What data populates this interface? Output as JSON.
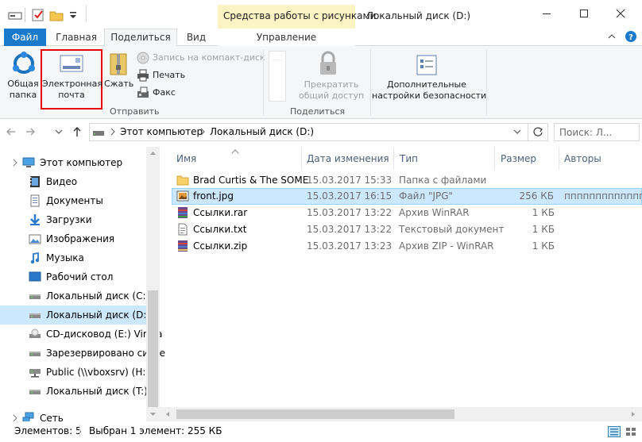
{
  "window": {
    "title": "Локальный диск (D:)",
    "contextual_tab_group": "Средства работы с рисунками"
  },
  "ribbon_tabs": {
    "file": "Файл",
    "home": "Главная",
    "share": "Поделиться",
    "view": "Вид",
    "manage": "Управление"
  },
  "ribbon": {
    "share_label": "Общая\nпапка",
    "share_l1": "Общая",
    "share_l2": "папка",
    "email_l1": "Электронная",
    "email_l2": "почта",
    "zip": "Сжать",
    "burn": "Запись на компакт-диск",
    "print": "Печать",
    "fax": "Факс",
    "group_send": "Отправить",
    "stop_l1": "Прекратить",
    "stop_l2": "общий доступ",
    "group_share": "Поделиться",
    "security_l1": "Дополнительные",
    "security_l2": "настройки безопасности"
  },
  "address": {
    "segment1": "Этот компьютер",
    "segment2": "Локальный диск (D:)",
    "search_placeholder": "Поиск: Л..."
  },
  "nav": {
    "items": [
      {
        "label": "Этот компьютер",
        "icon": "computer-icon"
      },
      {
        "label": "Видео",
        "icon": "video-icon"
      },
      {
        "label": "Документы",
        "icon": "documents-icon"
      },
      {
        "label": "Загрузки",
        "icon": "downloads-icon"
      },
      {
        "label": "Изображения",
        "icon": "pictures-icon"
      },
      {
        "label": "Музыка",
        "icon": "music-icon"
      },
      {
        "label": "Рабочий стол",
        "icon": "desktop-icon"
      },
      {
        "label": "Локальный диск (C:)",
        "icon": "drive-icon"
      },
      {
        "label": "Локальный диск (D:)",
        "icon": "drive-icon"
      },
      {
        "label": "CD-дисковод (E:) Virtua",
        "icon": "cd-drive-icon"
      },
      {
        "label": "Зарезервировано систе",
        "icon": "drive-icon"
      },
      {
        "label": "Public (\\\\vboxsrv) (H:)",
        "icon": "network-drive-icon"
      },
      {
        "label": "Локальный диск (T:)",
        "icon": "drive-icon"
      },
      {
        "label": "Сеть",
        "icon": "network-icon"
      }
    ]
  },
  "columns": {
    "name": "Имя",
    "date": "Дата изменения",
    "type": "Тип",
    "size": "Размер",
    "authors": "Авторы"
  },
  "files": [
    {
      "name": "Brad Curtis & The SOME",
      "date": "15.03.2017 15:33",
      "type": "Папка с файлами",
      "size": "",
      "authors": "",
      "icon": "folder-icon"
    },
    {
      "name": "front.jpg",
      "date": "15.03.2017 16:15",
      "type": "Файл \"JPG\"",
      "size": "256 КБ",
      "authors": "пппппппппппппп",
      "icon": "image-file-icon"
    },
    {
      "name": "Ссылки.rar",
      "date": "15.03.2017 13:22",
      "type": "Архив WinRAR",
      "size": "1 КБ",
      "authors": "",
      "icon": "rar-file-icon"
    },
    {
      "name": "Ссылки.txt",
      "date": "15.03.2017 13:22",
      "type": "Текстовый документ",
      "size": "1 КБ",
      "authors": "",
      "icon": "text-file-icon"
    },
    {
      "name": "Ссылки.zip",
      "date": "15.03.2017 13:23",
      "type": "Архив ZIP - WinRAR",
      "size": "1 КБ",
      "authors": "",
      "icon": "zip-file-icon"
    }
  ],
  "status": {
    "count": "Элементов: 5",
    "selected": "Выбран 1 элемент: 255 КБ"
  },
  "colors": {
    "accent": "#1979ca",
    "selection": "#cce8ff",
    "context_tab": "#fbf3c4",
    "highlight_border": "#e60000"
  }
}
